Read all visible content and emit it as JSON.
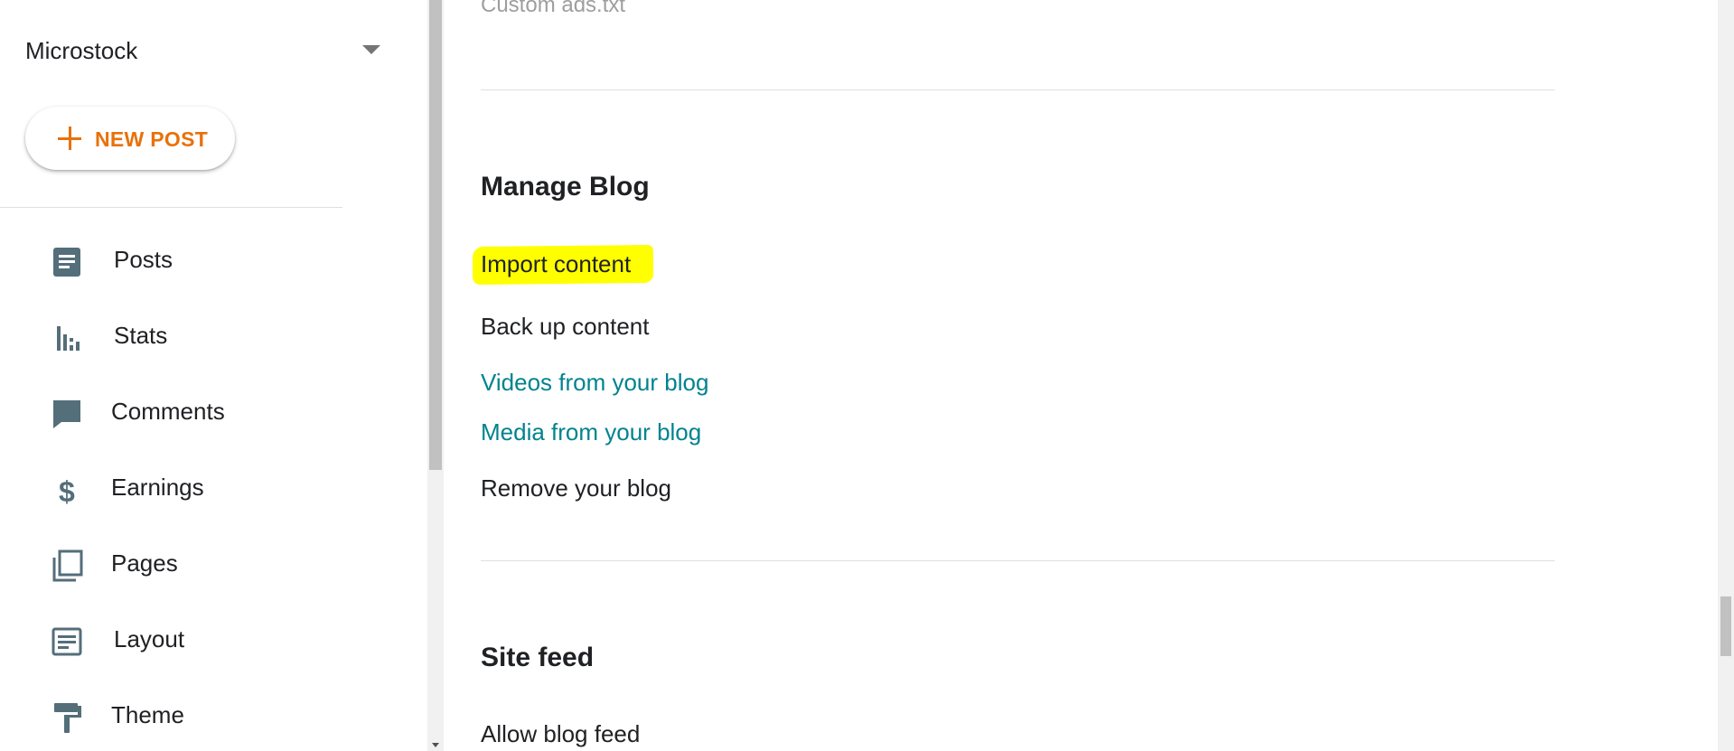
{
  "sidebar": {
    "blog_name": "Microstock",
    "new_post_label": "NEW POST",
    "items": [
      {
        "label": "Posts",
        "icon": "posts-icon"
      },
      {
        "label": "Stats",
        "icon": "stats-icon"
      },
      {
        "label": "Comments",
        "icon": "comments-icon"
      },
      {
        "label": "Earnings",
        "icon": "earnings-icon"
      },
      {
        "label": "Pages",
        "icon": "pages-icon"
      },
      {
        "label": "Layout",
        "icon": "layout-icon"
      },
      {
        "label": "Theme",
        "icon": "theme-icon"
      }
    ]
  },
  "main": {
    "previous_item": "Custom ads.txt",
    "manage_blog": {
      "title": "Manage Blog",
      "items": [
        {
          "label": "Import content",
          "highlighted": true
        },
        {
          "label": "Back up content"
        },
        {
          "label": "Videos from your blog",
          "style": "link"
        },
        {
          "label": "Media from your blog",
          "style": "link"
        },
        {
          "label": "Remove your blog"
        }
      ]
    },
    "site_feed": {
      "title": "Site feed",
      "items": [
        {
          "label": "Allow blog feed"
        }
      ]
    }
  },
  "colors": {
    "accent": "#e8710a",
    "link": "#00838f",
    "icon": "#546e7a",
    "highlight": "#ffff00"
  }
}
